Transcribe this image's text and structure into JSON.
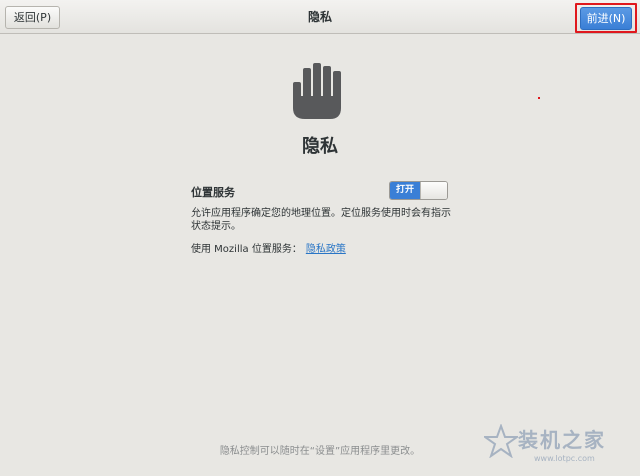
{
  "header": {
    "back_label": "返回(P)",
    "title": "隐私",
    "next_label": "前进(N)"
  },
  "main": {
    "icon": "hand-stop-icon",
    "section_title": "隐私",
    "location_label": "位置服务",
    "toggle_on_label": "打开",
    "description": "允许应用程序确定您的地理位置。定位服务使用时会有指示状态提示。",
    "mozilla_text": "使用 Mozilla 位置服务：",
    "policy_link": "隐私政策"
  },
  "footer": {
    "text": "隐私控制可以随时在“设置”应用程序里更改。"
  },
  "watermark": {
    "text": "装机之家",
    "url": "www.lotpc.com"
  },
  "colors": {
    "accent": "#3a7fd6",
    "highlight_box": "#e0181d",
    "background": "#e8e7e3",
    "link": "#2a76c6"
  }
}
